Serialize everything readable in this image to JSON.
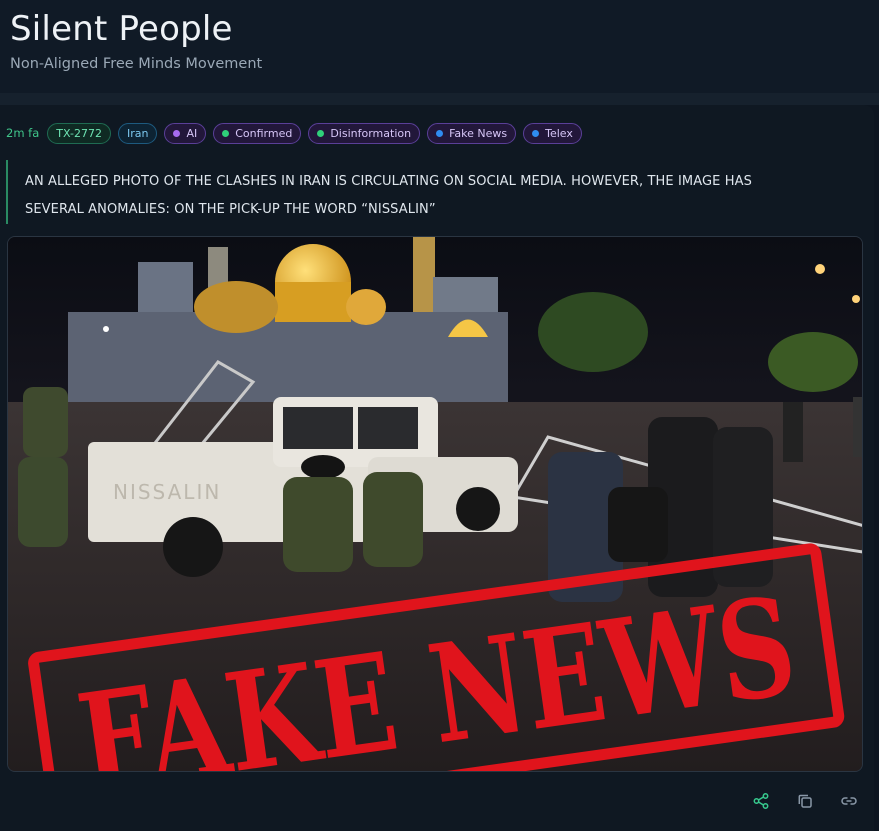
{
  "header": {
    "title": "Silent People",
    "subtitle": "Non-Aligned Free Minds Movement"
  },
  "post": {
    "time": "2m fa",
    "tags": [
      {
        "label": "TX-2772",
        "kind": "id"
      },
      {
        "label": "Iran",
        "kind": "place"
      },
      {
        "label": "AI",
        "kind": "category",
        "dot_color": "#a66bf0"
      },
      {
        "label": "Confirmed",
        "kind": "category",
        "dot_color": "#2fd07a"
      },
      {
        "label": "Disinformation",
        "kind": "category",
        "dot_color": "#2fd07a"
      },
      {
        "label": "Fake News",
        "kind": "category",
        "dot_color": "#2f8cf0"
      },
      {
        "label": "Telex",
        "kind": "category",
        "dot_color": "#2f8cf0"
      }
    ],
    "text_line1": "AN ALLEGED PHOTO OF THE CLASHES IN IRAN IS CIRCULATING ON SOCIAL MEDIA. HOWEVER, THE IMAGE HAS",
    "text_line2": "SEVERAL ANOMALIES: ON THE PICK-UP THE WORD “NISSALIN”",
    "image": {
      "stamp_text": "FAKE NEWS",
      "truck_text": "NISSALIN",
      "stamp_color": "#e0141c"
    },
    "actions": [
      {
        "name": "share",
        "icon": "share-icon"
      },
      {
        "name": "copy",
        "icon": "copy-icon"
      },
      {
        "name": "link",
        "icon": "link-icon"
      }
    ]
  },
  "colors": {
    "accent_green": "#3fc58a",
    "background": "#0d1520"
  }
}
